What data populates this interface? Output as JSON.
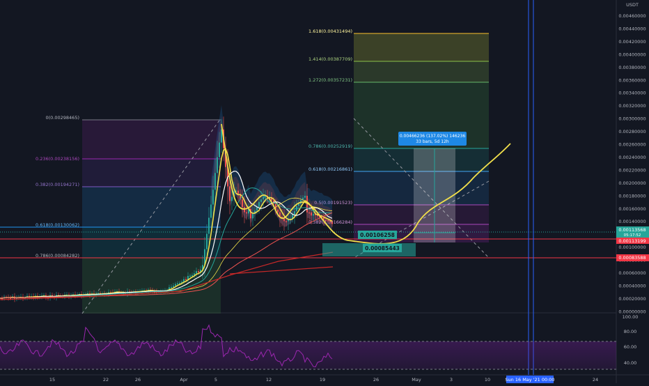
{
  "axis_unit": "USDT",
  "price_axis": {
    "ticks": [
      "0.00460000",
      "0.00440000",
      "0.00420000",
      "0.00400000",
      "0.00380000",
      "0.00360000",
      "0.00340000",
      "0.00320000",
      "0.00300000",
      "0.00280000",
      "0.00260000",
      "0.00240000",
      "0.00220000",
      "0.00200000",
      "0.00180000",
      "0.00160000",
      "0.00140000",
      "0.00120000",
      "0.00100000",
      "0.00080000",
      "0.00060000",
      "0.00040000",
      "0.00020000",
      "0.00000000"
    ],
    "markers": {
      "current": "0.00113568",
      "current_sub": "05:17:52",
      "red_line": "0.00113199",
      "support": "0.00083588"
    }
  },
  "rsi_axis": {
    "ticks": [
      "100.00",
      "80.00",
      "60.00",
      "40.00"
    ]
  },
  "time_axis": {
    "ticks": [
      "15",
      "22",
      "26",
      "Apr",
      "5",
      "12",
      "19",
      "26",
      "May",
      "3",
      "10",
      "17",
      "24"
    ],
    "crosshair_label": "Sun 16 May '21  00:00"
  },
  "fib_left": {
    "levels": [
      {
        "label": "0(0.00298465)"
      },
      {
        "label": "0.236(0.00238156)"
      },
      {
        "label": "0.382(0.00194271)"
      },
      {
        "label": "0.618(0.00130062)"
      },
      {
        "label": "0.786(0.00084282)"
      }
    ]
  },
  "fib_ext": {
    "levels": [
      {
        "label": "1.618(0.00431494)"
      },
      {
        "label": "1.414(0.00387709)"
      },
      {
        "label": "1.272(0.00357231)"
      },
      {
        "label": "0.786(0.00252919)"
      },
      {
        "label": "0.618(0.00216861)"
      },
      {
        "label": "0.5(0.00191523)"
      },
      {
        "label": "0.382(0.00166284)"
      }
    ]
  },
  "price_labels": {
    "entry": "0.00106258",
    "low": "0.00085443"
  },
  "measure_box": {
    "line1": "0.00466236 (137.02%) 146236",
    "line2": "33 bars, 5d 12h"
  },
  "colors": {
    "background": "#131722",
    "up": "#26a69a",
    "down": "#ef5350",
    "projection": "#f2e04b",
    "rsi": "#9c27b0",
    "crosshair": "#2962ff"
  }
}
